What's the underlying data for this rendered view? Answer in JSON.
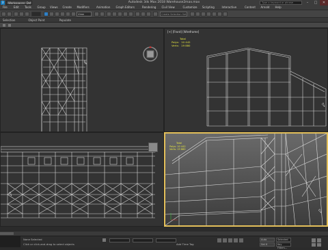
{
  "titlebar": {
    "app_logo": "3",
    "workspace": "Workspaces: Default",
    "window_title": "Autodesk 3ds Max 2018    Warehouse2max.max",
    "search_placeholder": "Type a keyword or phrase",
    "minimize": "–",
    "maximize": "□",
    "close": "✕"
  },
  "menu": [
    "File",
    "Edit",
    "Tools",
    "Group",
    "Views",
    "Create",
    "Modifiers",
    "Animation",
    "Graph Editors",
    "Rendering",
    "Civil View",
    "Customize",
    "Scripting",
    "Interactive",
    "Content",
    "Arnold",
    "Help"
  ],
  "toolbar": {
    "view_dropdown": "View",
    "selection_set": "Create Selection Set"
  },
  "ribbon_tabs": [
    "Selection",
    "Object Paint",
    "Populate"
  ],
  "viewports": {
    "top_left_label": "",
    "top_right_label": "[+] [Front] [Wireframe]",
    "bottom_left_label": "",
    "bottom_right_label": "[+] [Perspective]",
    "stats": {
      "title": "Total",
      "polys_label": "Polys:",
      "polys_value": "10 442",
      "verts_label": "Verts:",
      "verts_value": "19 880"
    }
  },
  "status": {
    "left_text": "None Selected",
    "hint_text": "Click or click-and-drag to select objects",
    "add_time_tag": "Add Time Tag",
    "auto_key": "Auto",
    "set_key": "Set K",
    "selected_dropdown": "Selected",
    "key_filters": "Key Filters..."
  },
  "colors": {
    "accent_active": "#2f7fc4",
    "viewport_active_border": "#e4c05a",
    "wire_white": "#d8d8d8",
    "stat_yellow": "#e6e640"
  },
  "icons": {
    "viewcube": "viewcube-icon",
    "nav_orbit": "orbit-icon",
    "nav_zoom": "zoom-icon",
    "nav_pan": "pan-icon"
  }
}
